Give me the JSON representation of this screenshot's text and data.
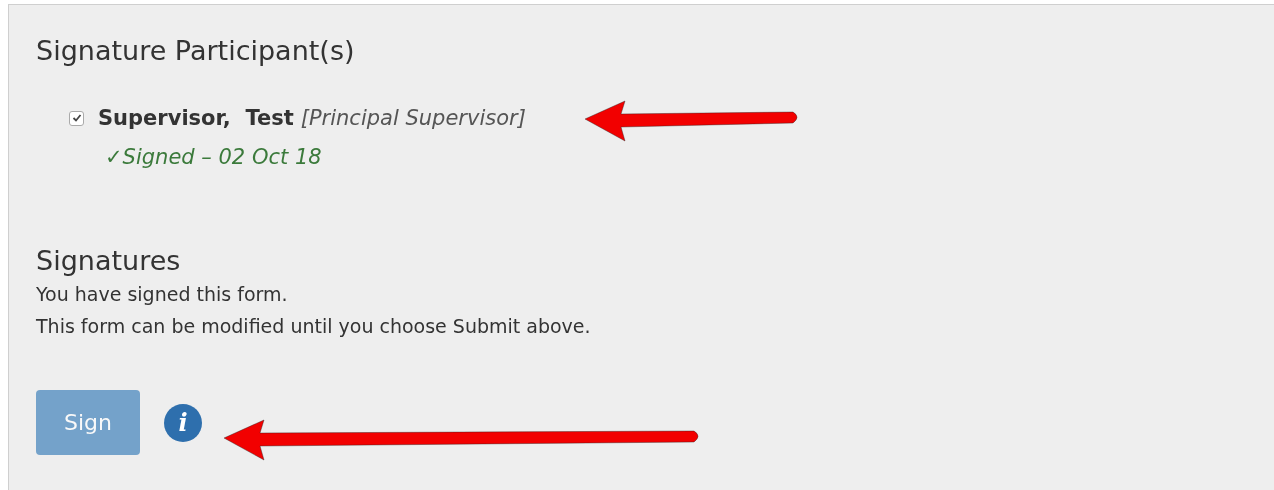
{
  "participants_section": {
    "heading": "Signature Participant(s)",
    "participants": [
      {
        "name": "Supervisor,  Test",
        "role": "[Principal Supervisor]",
        "checked": true,
        "status": "✓Signed – 02 Oct 18"
      }
    ]
  },
  "signatures_section": {
    "heading": "Signatures",
    "lines": [
      "You have signed this form.",
      "This form can be modified until you choose Submit above."
    ],
    "button": {
      "label": "Sign",
      "disabled": true
    },
    "info_icon": "i"
  }
}
